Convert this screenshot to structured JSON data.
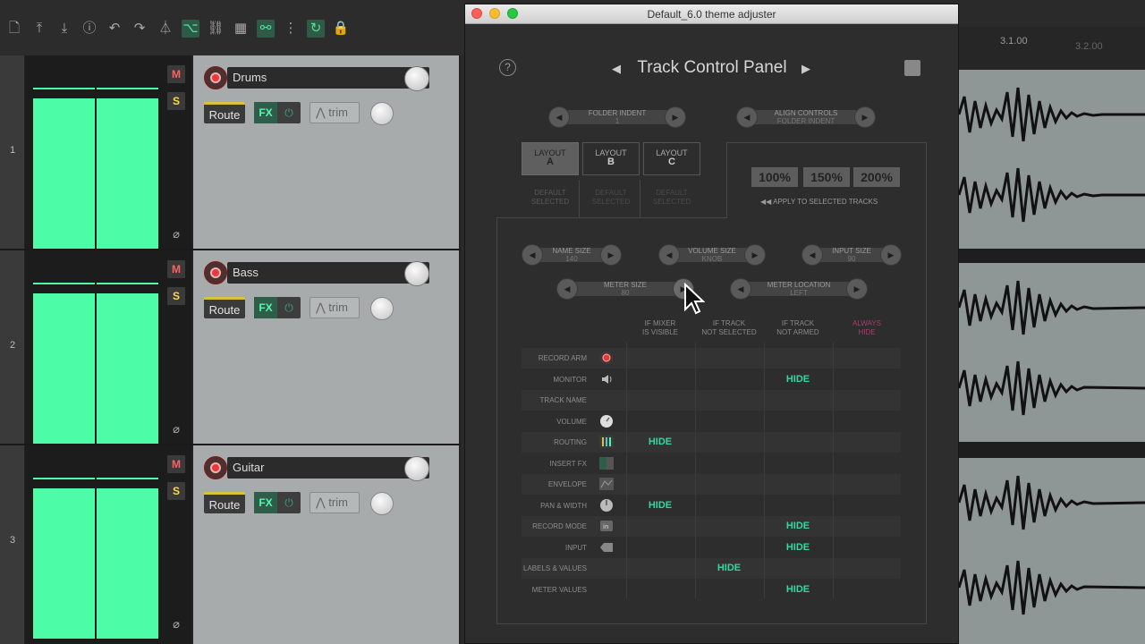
{
  "window": {
    "title": "Default_6.0 theme adjuster"
  },
  "toolbar": {
    "icons": [
      "new-project-icon",
      "save-icon",
      "download-icon",
      "info-icon",
      "undo-icon",
      "redo-icon",
      "metronome-icon",
      "ripple-icon",
      "link-icon",
      "grid-icon",
      "snap-icon",
      "dotted-grid-icon",
      "loop-icon",
      "lock-icon"
    ]
  },
  "tracks": [
    {
      "number": "1",
      "name": "Drums",
      "mute": "M",
      "solo": "S",
      "route": "Route",
      "fx": "FX",
      "trim": "trim"
    },
    {
      "number": "2",
      "name": "Bass",
      "mute": "M",
      "solo": "S",
      "route": "Route",
      "fx": "FX",
      "trim": "trim"
    },
    {
      "number": "3",
      "name": "Guitar",
      "mute": "M",
      "solo": "S",
      "route": "Route",
      "fx": "FX",
      "trim": "trim"
    }
  ],
  "ruler": {
    "labels": [
      "3.1.00",
      "3.2.00"
    ]
  },
  "adjuster": {
    "help": "?",
    "panel_title": "Track Control Panel",
    "prev_arrow": "◀",
    "next_arrow": "▶",
    "folder_indent": {
      "label": "FOLDER INDENT",
      "value": "1"
    },
    "align_controls": {
      "label": "ALIGN CONTROLS",
      "value": "FOLDER INDENT"
    },
    "layouts": [
      {
        "top": "LAYOUT",
        "letter": "A",
        "default1": "DEFAULT",
        "default2": "SELECTED"
      },
      {
        "top": "LAYOUT",
        "letter": "B",
        "default1": "DEFAULT",
        "default2": "SELECTED"
      },
      {
        "top": "LAYOUT",
        "letter": "C",
        "default1": "DEFAULT",
        "default2": "SELECTED"
      }
    ],
    "scales": [
      "100%",
      "150%",
      "200%"
    ],
    "apply_label": "◀◀  APPLY TO SELECTED TRACKS",
    "name_size": {
      "label": "NAME SIZE",
      "value": "140"
    },
    "volume_size": {
      "label": "VOLUME SIZE",
      "value": "KNOB"
    },
    "input_size": {
      "label": "INPUT SIZE",
      "value": "90"
    },
    "meter_size": {
      "label": "METER SIZE",
      "value": "80"
    },
    "meter_location": {
      "label": "METER LOCATION",
      "value": "LEFT"
    },
    "columns": [
      {
        "l1": "IF MIXER",
        "l2": "IS VISIBLE"
      },
      {
        "l1": "IF TRACK",
        "l2": "NOT SELECTED"
      },
      {
        "l1": "IF TRACK",
        "l2": "NOT ARMED"
      },
      {
        "l1": "ALWAYS",
        "l2": "HIDE"
      }
    ],
    "rows": [
      {
        "label": "RECORD ARM",
        "icon": "record-arm-icon",
        "hide": []
      },
      {
        "label": "MONITOR",
        "icon": "speaker-icon",
        "hide": [
          2
        ]
      },
      {
        "label": "TRACK NAME",
        "icon": "",
        "hide": []
      },
      {
        "label": "VOLUME",
        "icon": "knob-icon",
        "hide": []
      },
      {
        "label": "ROUTING",
        "icon": "routing-icon",
        "hide": [
          0
        ]
      },
      {
        "label": "INSERT FX",
        "icon": "fx-icon",
        "hide": []
      },
      {
        "label": "ENVELOPE",
        "icon": "envelope-icon",
        "hide": []
      },
      {
        "label": "PAN & WIDTH",
        "icon": "pan-knob-icon",
        "hide": [
          0
        ]
      },
      {
        "label": "RECORD MODE",
        "icon": "record-mode-icon",
        "hide": [
          2
        ]
      },
      {
        "label": "INPUT",
        "icon": "input-icon",
        "hide": [
          2
        ]
      },
      {
        "label": "LABELS & VALUES",
        "icon": "",
        "hide": [
          1
        ]
      },
      {
        "label": "METER VALUES",
        "icon": "",
        "hide": [
          2
        ]
      }
    ],
    "hide_text": "HIDE"
  },
  "colors": {
    "meter": "#4dfca6",
    "hide": "#35d6a0",
    "always_hide": "#b03a6a",
    "record": "#e63a3a"
  }
}
